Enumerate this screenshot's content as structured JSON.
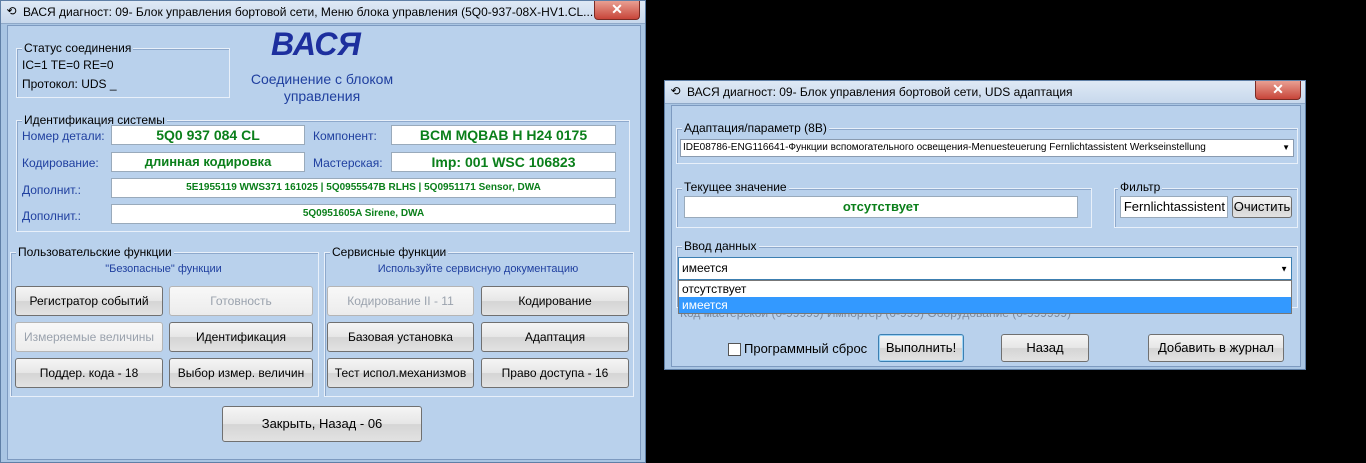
{
  "left_window": {
    "title": "ВАСЯ диагност: 09- Блок управления бортовой сети,  Меню блока управления (5Q0-937-08X-HV1.CL...",
    "close": "✕",
    "logo": "ВАСЯ",
    "logo_sub": "Соединение с блоком управления",
    "status": {
      "label": "Статус соединения",
      "line1": "IC=1  TE=0   RE=0",
      "line2": "Протокол: UDS        _"
    },
    "ident": {
      "label": "Идентификация системы",
      "part_label": "Номер детали:",
      "part_value": "5Q0 937 084 CL",
      "component_label": "Компонент:",
      "component_value": "BCM MQBAB H    H24 0175",
      "coding_label": "Кодирование:",
      "coding_value": "длинная кодировка",
      "shop_label": "Мастерская:",
      "shop_value": "Imp: 001      WSC 106823",
      "extra_label": "Дополнит.:",
      "extra1_value": "5E1955119  WWS371 161025  |  5Q0955547B RLHS  |  5Q0951171  Sensor, DWA",
      "extra2_label": "Дополнит.:",
      "extra2_value": "5Q0951605A Sirene, DWA"
    },
    "user_funcs": {
      "label": "Пользовательские функции",
      "sub": "\"Безопасные\" функции",
      "btn1": "Регистратор событий",
      "btn2": "Готовность",
      "btn3": "Измеряемые величины",
      "btn4": "Идентификация",
      "btn5": "Поддер. кода - 18",
      "btn6": "Выбор измер. величин"
    },
    "service_funcs": {
      "label": "Сервисные функции",
      "sub": "Используйте сервисную документацию",
      "btn1": "Кодирование II - 11",
      "btn2": "Кодирование",
      "btn3": "Базовая установка",
      "btn4": "Адаптация",
      "btn5": "Тест испол.механизмов",
      "btn6": "Право доступа - 16"
    },
    "close_btn": "Закрыть, Назад - 06"
  },
  "right_window": {
    "title": "ВАСЯ диагност: 09- Блок управления бортовой сети,  UDS адаптация",
    "close": "✕",
    "adapt_label": "Адаптация/параметр (8B)",
    "adapt_value": "IDE08786-ENG116641-Функции вспомогательного освещения-Menuesteuerung Fernlichtassistent Werkseinstellung",
    "current_label": "Текущее значение",
    "current_value": "отсутствует",
    "filter_label": "Фильтр",
    "filter_value": "Fernlichtassistent",
    "clear_btn": "Очистить",
    "input_label": "Ввод данных",
    "input_value": "имеется",
    "options": [
      "отсутствует",
      "имеется"
    ],
    "hidden_row": "Код мастерской (0-99999)          Импортер (0-999)         Оборудование (0-999999)",
    "checkbox_label": "Программный сброс",
    "exec_btn": "Выполнить!",
    "back_btn": "Назад",
    "log_btn": "Добавить в журнал"
  }
}
